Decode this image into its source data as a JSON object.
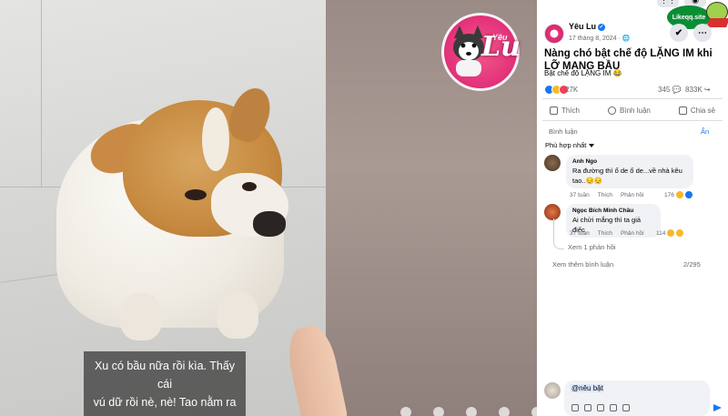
{
  "video": {
    "subtitle_line1": "Xu có bầu nữa rồi kìa. Thấy cái",
    "subtitle_line2": "vú dữ rồi nè, nè! Tao nằm ra",
    "logo_word": "Lu",
    "logo_small": "Yêu"
  },
  "watermark": {
    "text": "Likeqq.site"
  },
  "post": {
    "page_name": "Yêu Lu",
    "date": "17 tháng 8, 2024 · 🌐",
    "title": "Nàng chó bật chế độ LẶNG IM khi LỠ MANG BẦU",
    "subtitle": "Bật chế độ LẶNG IM 😂",
    "reaction_count": "27K",
    "comment_count": "345 💬",
    "share_count": "833K ↪",
    "actions": {
      "like": "Thích",
      "comment": "Bình luận",
      "share": "Chia sẻ"
    }
  },
  "comments_section": {
    "label": "Bình luận",
    "hide": "Ẩn",
    "sort": "Phù hợp nhất",
    "comments": [
      {
        "name": "Anh Ngo",
        "text_line1": "Ra đường thì ổ de ổ de...về nhà kêu",
        "text_line2": "tao..😔😔",
        "time": "37 tuần",
        "like": "Thích",
        "reply": "Phản hồi",
        "reactions": "176"
      },
      {
        "name": "Ngọc Bích Minh Châu",
        "text_line1": "Ai chửi mắng thì ta giả điếc",
        "time": "37 tuần",
        "like": "Thích",
        "reply": "Phản hồi",
        "reactions": "114"
      }
    ],
    "view_replies": "Xem 1 phản hồi",
    "more_comments": "Xem thêm bình luận",
    "count": "2/295"
  },
  "composer": {
    "value": "@nêu bật"
  },
  "colors": {
    "accent": "#1877f2",
    "logo": "#e4337a"
  }
}
